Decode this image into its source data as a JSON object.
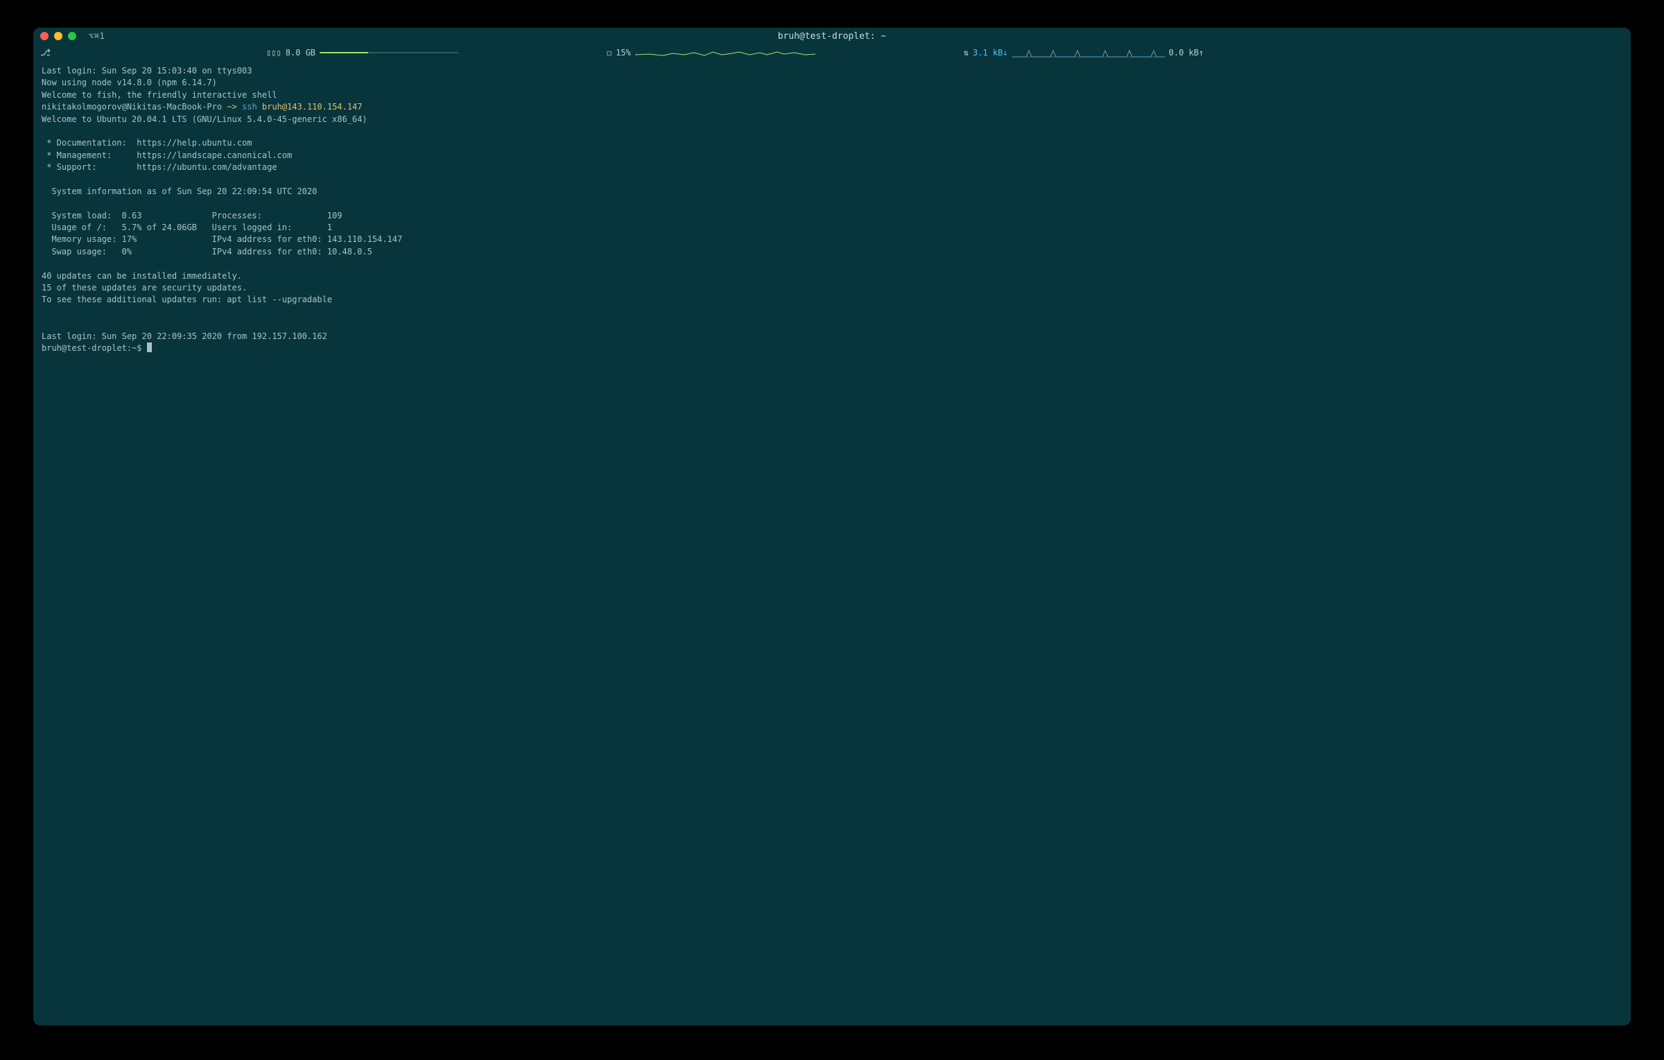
{
  "titlebar": {
    "tab_shortcut": "⌥⌘1",
    "title": "bruh@test-droplet: ~"
  },
  "statusbar": {
    "git_branch_icon": "⎇",
    "mem_icon": "▯▯▯",
    "mem_label": "8.0 GB",
    "cpu_icon": "◻",
    "cpu_label": "15%",
    "net_icon": "⇅",
    "net_down": "3.1 kB↓",
    "net_up": "0.0 kB↑"
  },
  "term": {
    "l01": "Last login: Sun Sep 20 15:03:40 on ttys003",
    "l02": "Now using node v14.8.0 (npm 6.14.7)",
    "l03": "Welcome to fish, the friendly interactive shell",
    "prompt1_user": "nikitakolmogorov@Nikitas-MacBook-Pro",
    "prompt1_sep": " ~> ",
    "prompt1_cmd": "ssh",
    "prompt1_arg": "bruh@143.110.154.147",
    "l05": "Welcome to Ubuntu 20.04.1 LTS (GNU/Linux 5.4.0-45-generic x86_64)",
    "l07": " * Documentation:  https://help.ubuntu.com",
    "l08": " * Management:     https://landscape.canonical.com",
    "l09": " * Support:        https://ubuntu.com/advantage",
    "l11": "  System information as of Sun Sep 20 22:09:54 UTC 2020",
    "l13": "  System load:  0.63              Processes:             109",
    "l14": "  Usage of /:   5.7% of 24.06GB   Users logged in:       1",
    "l15": "  Memory usage: 17%               IPv4 address for eth0: 143.110.154.147",
    "l16": "  Swap usage:   0%                IPv4 address for eth0: 10.48.0.5",
    "l18": "40 updates can be installed immediately.",
    "l19": "15 of these updates are security updates.",
    "l20": "To see these additional updates run: apt list --upgradable",
    "l22": "Last login: Sun Sep 20 22:09:35 2020 from 192.157.100.162",
    "prompt2": "bruh@test-droplet:~$ "
  }
}
